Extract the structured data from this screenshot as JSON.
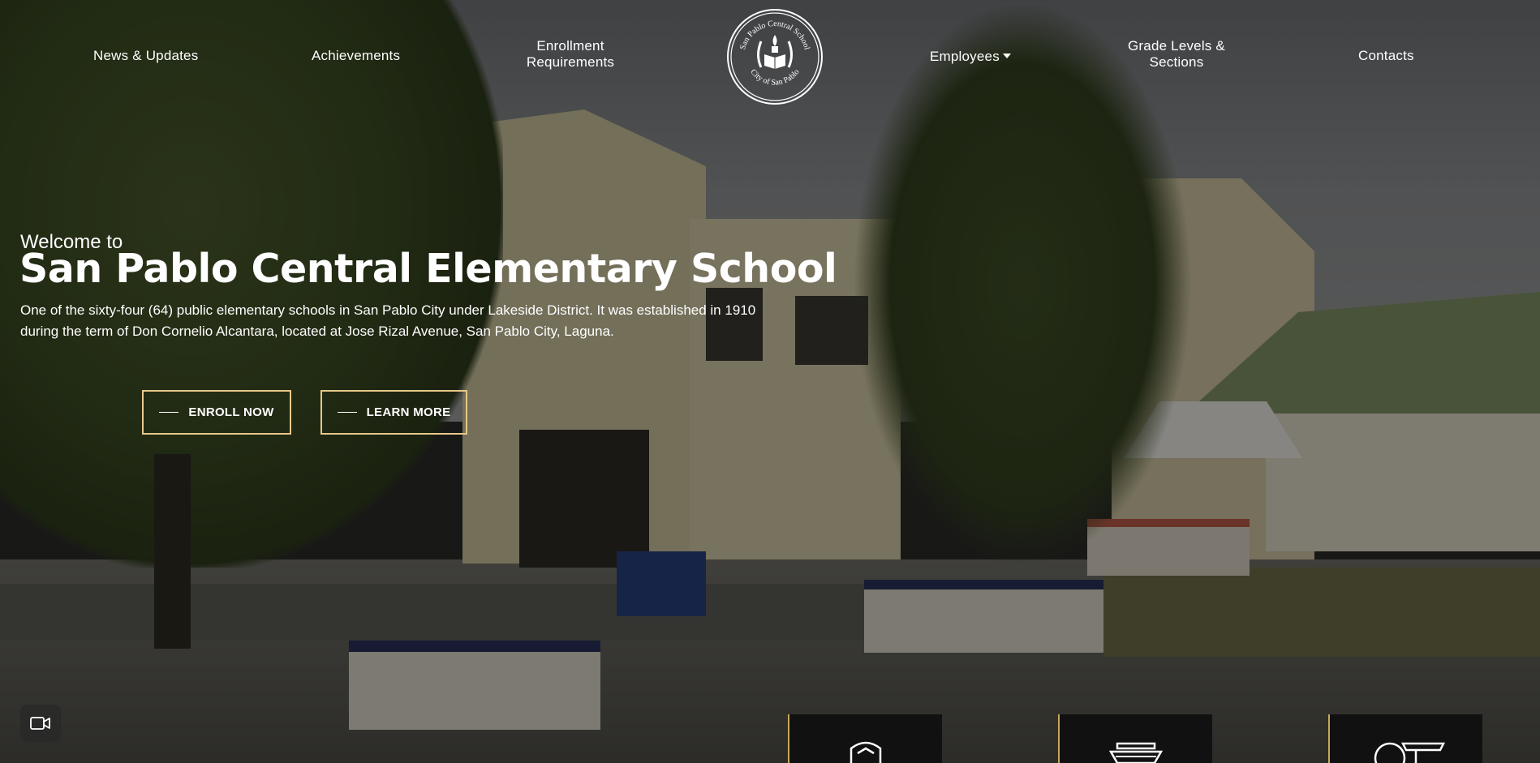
{
  "nav": {
    "news": "News & Updates",
    "achievements": "Achievements",
    "enrollment": "Enrollment Requirements",
    "employees": "Employees",
    "grade_levels": "Grade Levels & Sections",
    "contacts": "Contacts"
  },
  "logo": {
    "top_text": "San Pablo Central School",
    "bottom_text": "City of San Pablo"
  },
  "hero": {
    "welcome": "Welcome to",
    "title": "San Pablo Central Elementary School",
    "description": "One of the sixty-four (64) public elementary schools in San Pablo City under Lakeside District. It was established in 1910 during the term of Don Cornelio Alcantara, located at Jose Rizal Avenue, San Pablo City, Laguna."
  },
  "buttons": {
    "enroll": "ENROLL NOW",
    "learn": "LEARN MORE"
  },
  "icons": {
    "video": "video-camera-icon",
    "card1": "shield-icon",
    "card2": "ship-icon",
    "card3": "tools-icon"
  },
  "colors": {
    "accent_border": "#e8c88a",
    "card_background": "#111111",
    "card_accent": "#c9a85a"
  }
}
